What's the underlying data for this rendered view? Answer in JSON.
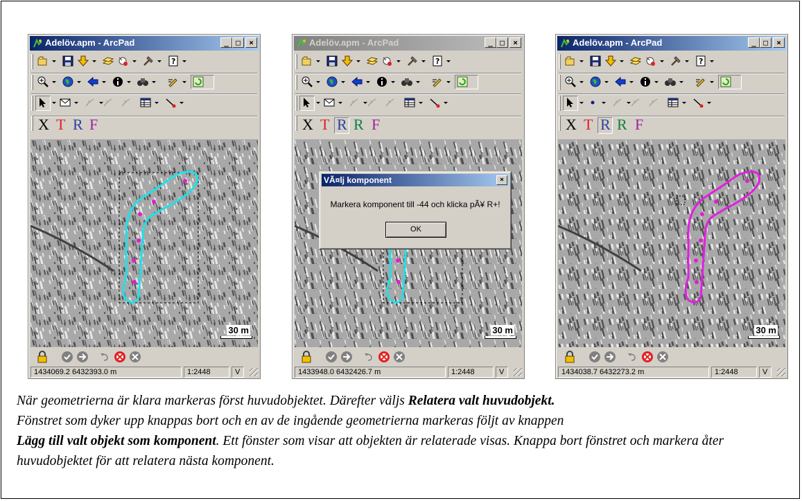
{
  "windows": [
    {
      "title": "Adelöv.apm - ArcPad",
      "active": true,
      "status": {
        "coords": "1434069.2 6432393.0 m",
        "scale": "1:2448",
        "v": "V"
      },
      "scale_label": "30 m",
      "geometry_color": "#20e0e8",
      "show_rplus": false,
      "point_tool": false
    },
    {
      "title": "Adelöv.apm - ArcPad",
      "active": false,
      "status": {
        "coords": "1433948.0 6432426.7 m",
        "scale": "1:2448",
        "v": "V"
      },
      "scale_label": "30 m",
      "geometry_color": "#20e0e8",
      "show_rplus": true,
      "point_tool": false
    },
    {
      "title": "Adelöv.apm - ArcPad",
      "active": true,
      "status": {
        "coords": "1434038.7 6432273.2 m",
        "scale": "1:2448",
        "v": "V"
      },
      "scale_label": "30 m",
      "geometry_color": "#e020e0",
      "show_rplus": true,
      "point_tool": true
    }
  ],
  "edit_letters": {
    "x": "X",
    "t": "T",
    "r": "R",
    "rplus": "R",
    "f": "F"
  },
  "caption_buttons": {
    "minimize": "_",
    "maximize": "□",
    "close": "×"
  },
  "dialog": {
    "title": "VÃ¤lj komponent",
    "message": "Markera komponent till -44 och klicka pÃ¥ R+!",
    "ok": "OK",
    "close": "×"
  },
  "caption": {
    "p1": "När geometrierna är klara markeras först huvudobjektet. Därefter väljs ",
    "b1": "Relatera valt huvudobjekt.",
    "p2": "Fönstret som dyker upp knappas bort och en av de ingående geometrierna markeras följt av knappen ",
    "b2": "Lägg till valt objekt som komponent",
    "p3": ". Ett fönster som visar att objekten är relaterade visas. Knappa bort fönstret och markera åter huvudobjektet för att relatera nästa komponent."
  },
  "icons": [
    "open-icon",
    "save-icon",
    "add-layer-icon",
    "layers-icon",
    "gps-icon",
    "tools-icon",
    "help-icon",
    "zoom-in-icon",
    "globe-icon",
    "back-icon",
    "identify-icon",
    "find-icon",
    "edit-icon",
    "refresh-icon",
    "select-arrow-icon",
    "envelope-icon",
    "vertex-icon",
    "table-icon",
    "line-tool-icon",
    "lock-icon",
    "check-icon",
    "forward-icon",
    "undo-icon",
    "cancel-icon",
    "close-circle-icon"
  ]
}
